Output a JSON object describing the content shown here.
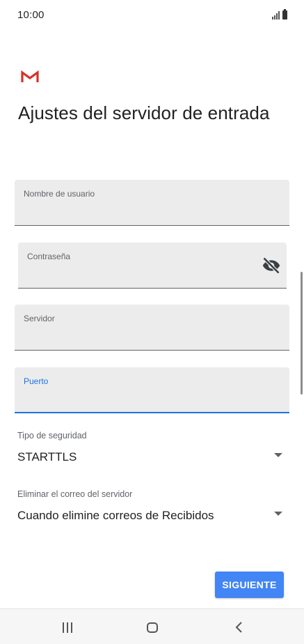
{
  "status_bar": {
    "time": "10:00",
    "icons": [
      "signal-icon",
      "battery-icon"
    ]
  },
  "app": {
    "logo": "gmail-logo",
    "page_title": "Ajustes del servidor de entrada"
  },
  "form": {
    "username": {
      "label": "Nombre de usuario",
      "value": ""
    },
    "password": {
      "label": "Contraseña",
      "value": "",
      "toggle_icon": "visibility-off-icon"
    },
    "server": {
      "label": "Servidor",
      "value": ""
    },
    "port": {
      "label": "Puerto",
      "value": "",
      "focused": true
    },
    "security_type": {
      "label": "Tipo de seguridad",
      "value": "STARTTLS"
    },
    "delete_from_server": {
      "label": "Eliminar el correo del servidor",
      "value": "Cuando elimine correos de Recibidos"
    }
  },
  "actions": {
    "next_label": "SIGUIENTE"
  },
  "nav_bar": {
    "icons": [
      "recent-apps-icon",
      "home-icon",
      "back-icon"
    ]
  },
  "colors": {
    "accent": "#1a73e8",
    "button": "#4285f4",
    "field_bg": "#ececec",
    "gmail_red": "#d93025"
  }
}
